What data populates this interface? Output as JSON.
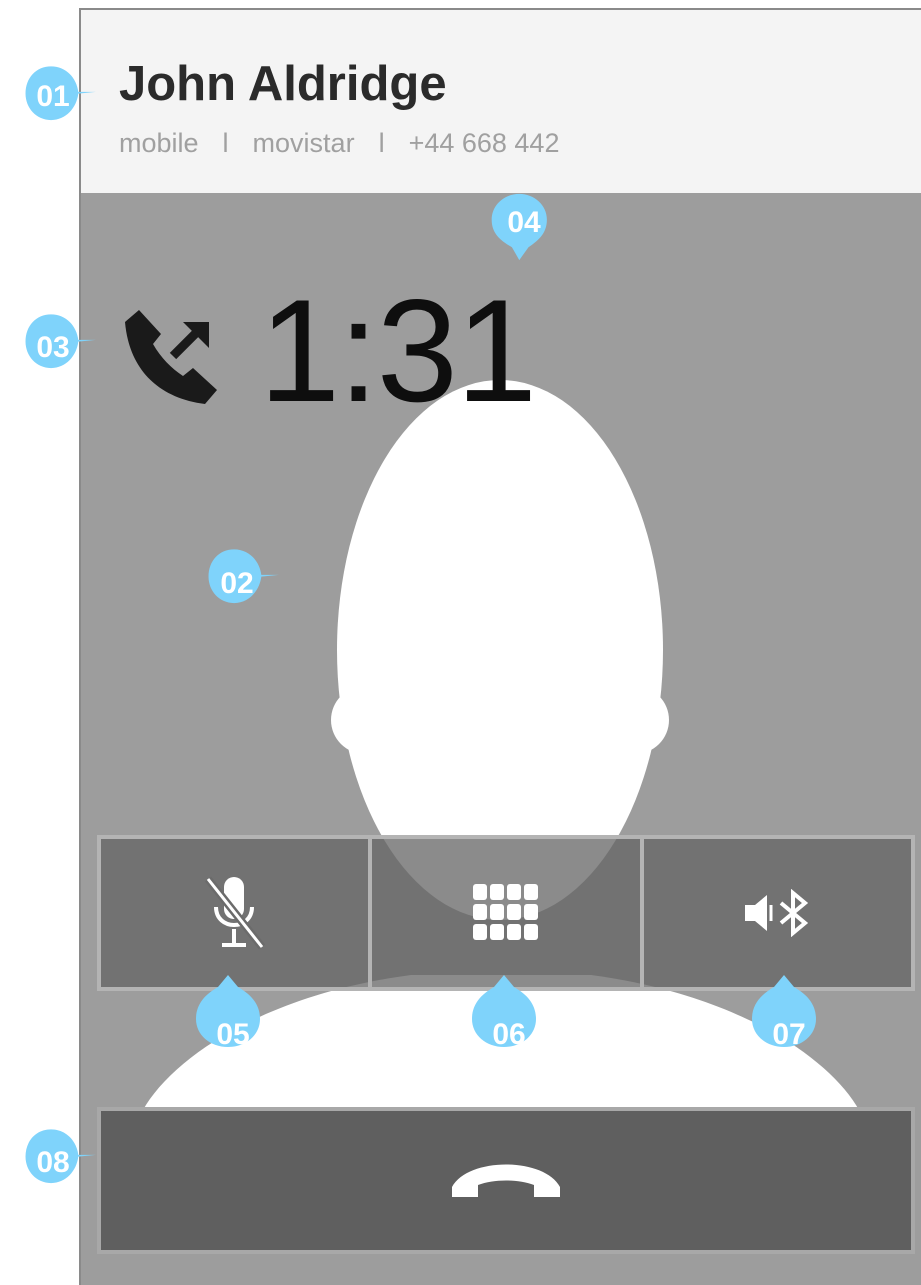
{
  "contact": {
    "name": "John Aldridge",
    "line_type": "mobile",
    "separator": "l",
    "carrier": "movistar",
    "number": "+44 668 442"
  },
  "call": {
    "timer": "1:31",
    "direction_icon": "outgoing-call-icon"
  },
  "controls": {
    "mute_icon": "microphone-muted-icon",
    "keypad_icon": "keypad-icon",
    "audio_icon": "speaker-bluetooth-icon",
    "end_call_icon": "end-call-icon"
  },
  "annotations": {
    "m01": "01",
    "m02": "02",
    "m03": "03",
    "m04": "04",
    "m05": "05",
    "m06": "06",
    "m07": "07",
    "m08": "08"
  },
  "colors": {
    "marker": "#7fd3fb",
    "background": "#9d9d9d",
    "header": "#f4f4f4",
    "end_button": "#5f5f5f"
  }
}
